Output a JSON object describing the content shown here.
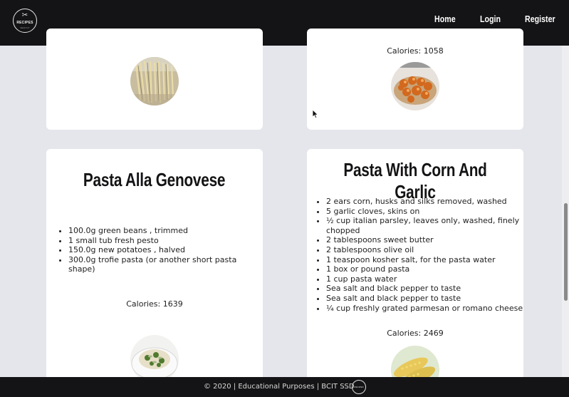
{
  "navbar": {
    "logo_text": "RECIPES",
    "logo_tagline": "HEALTHY",
    "links": [
      {
        "label": "Home"
      },
      {
        "label": "Login"
      },
      {
        "label": "Register"
      }
    ]
  },
  "cards": {
    "top_left": {
      "image_icon": "pasta-bundle-image"
    },
    "top_right": {
      "calories": "Calories: 1058",
      "image_icon": "fried-pasta-image"
    },
    "bottom_left": {
      "title": "Pasta Alla Genovese",
      "ingredients": [
        "100.0g green beans , trimmed",
        "1 small tub fresh pesto",
        "150.0g new potatoes , halved",
        "300.0g trofie pasta (or another short pasta shape)"
      ],
      "calories": "Calories: 1639",
      "image_icon": "pesto-pasta-bowl-image"
    },
    "bottom_right": {
      "title": "Pasta With Corn And Garlic",
      "ingredients": [
        "2 ears corn, husks and silks removed, washed",
        "5 garlic cloves, skins on",
        "½ cup italian parsley, leaves only, washed, finely chopped",
        "2 tablespoons sweet butter",
        "2 tablespoons olive oil",
        "1 teaspoon kosher salt, for the pasta water",
        "1 box or pound pasta",
        "1 cup pasta water",
        "Sea salt and black pepper to taste",
        "Sea salt and black pepper to taste",
        "¼ cup freshly grated parmesan or romano cheese"
      ],
      "calories": "Calories: 2469",
      "image_icon": "corn-image"
    }
  },
  "footer": {
    "text": "© 2020 | Educational Purposes | BCIT SSD",
    "logo_text": "RECIPES"
  },
  "colors": {
    "navbar": "#141315",
    "page_background": "#e4e6ec",
    "card_background": "#ffffff"
  }
}
